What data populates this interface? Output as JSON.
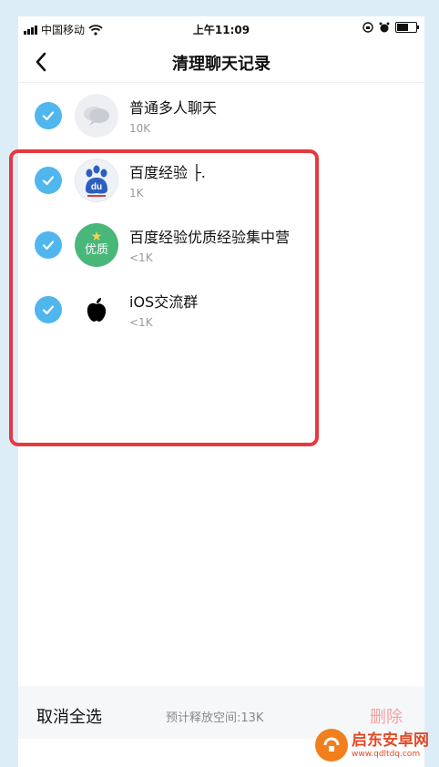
{
  "status_bar": {
    "carrier": "中国移动",
    "time": "上午11:09"
  },
  "nav": {
    "title": "清理聊天记录"
  },
  "chats": [
    {
      "name": "普通多人聊天",
      "size": "10K",
      "selected": true,
      "avatar": "group-chat-icon"
    },
    {
      "name": "百度经验 ├.",
      "size": "1K",
      "selected": true,
      "avatar": "baidu-paw-icon"
    },
    {
      "name": "百度经验优质经验集中营",
      "size": "<1K",
      "selected": true,
      "avatar": "youzhi-badge",
      "avatar_text": "优质"
    },
    {
      "name": "iOS交流群",
      "size": "<1K",
      "selected": true,
      "avatar": "apple-icon"
    }
  ],
  "bottom_bar": {
    "cancel_label": "取消全选",
    "release_label": "预计释放空间:13K",
    "delete_label": "删除"
  },
  "watermark": {
    "name": "启东安卓网",
    "url": "www.qdltdq.com"
  },
  "colors": {
    "accent": "#4fb6ee",
    "highlight": "#e5393f",
    "delete": "#f3a3a3",
    "background": "#dcedf8"
  }
}
